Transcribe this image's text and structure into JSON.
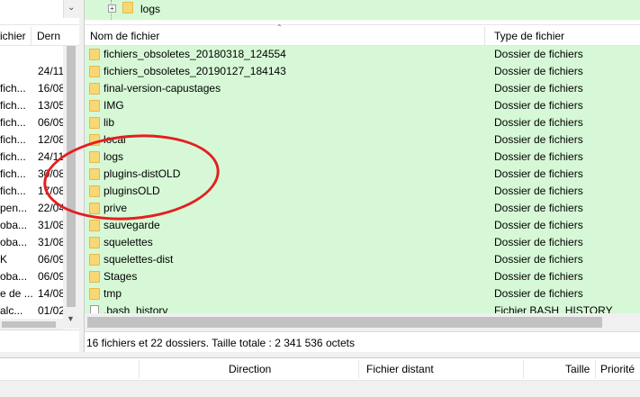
{
  "local_panel": {
    "columns": [
      "ichier",
      "Dern"
    ],
    "rows": [
      {
        "name": "",
        "date": ""
      },
      {
        "name": "",
        "date": "24/11"
      },
      {
        "name": "fich...",
        "date": "16/08"
      },
      {
        "name": "fich...",
        "date": "13/05"
      },
      {
        "name": "fich...",
        "date": "06/09"
      },
      {
        "name": "fich...",
        "date": "12/08"
      },
      {
        "name": "fich...",
        "date": "24/11"
      },
      {
        "name": "fich...",
        "date": "30/08"
      },
      {
        "name": "fich...",
        "date": "17/08"
      },
      {
        "name": "pen...",
        "date": "22/04"
      },
      {
        "name": "oba...",
        "date": "31/08"
      },
      {
        "name": "oba...",
        "date": "31/08"
      },
      {
        "name": "K",
        "date": "06/09"
      },
      {
        "name": "oba...",
        "date": "06/09"
      },
      {
        "name": "e de ...",
        "date": "14/08"
      },
      {
        "name": "alc...",
        "date": "01/02"
      }
    ]
  },
  "remote_panel": {
    "tree_item": "logs",
    "columns": {
      "name": "Nom de fichier",
      "type": "Type de fichier"
    },
    "rows": [
      {
        "name": "fichiers_obsoletes_20180318_124554",
        "type": "Dossier de fichiers",
        "icon": "folder"
      },
      {
        "name": "fichiers_obsoletes_20190127_184143",
        "type": "Dossier de fichiers",
        "icon": "folder"
      },
      {
        "name": "final-version-capustages",
        "type": "Dossier de fichiers",
        "icon": "folder"
      },
      {
        "name": "IMG",
        "type": "Dossier de fichiers",
        "icon": "folder"
      },
      {
        "name": "lib",
        "type": "Dossier de fichiers",
        "icon": "folder"
      },
      {
        "name": "local",
        "type": "Dossier de fichiers",
        "icon": "folder"
      },
      {
        "name": "logs",
        "type": "Dossier de fichiers",
        "icon": "folder"
      },
      {
        "name": "plugins-distOLD",
        "type": "Dossier de fichiers",
        "icon": "folder"
      },
      {
        "name": "pluginsOLD",
        "type": "Dossier de fichiers",
        "icon": "folder"
      },
      {
        "name": "prive",
        "type": "Dossier de fichiers",
        "icon": "folder"
      },
      {
        "name": "sauvegarde",
        "type": "Dossier de fichiers",
        "icon": "folder"
      },
      {
        "name": "squelettes",
        "type": "Dossier de fichiers",
        "icon": "folder"
      },
      {
        "name": "squelettes-dist",
        "type": "Dossier de fichiers",
        "icon": "folder"
      },
      {
        "name": "Stages",
        "type": "Dossier de fichiers",
        "icon": "folder"
      },
      {
        "name": "tmp",
        "type": "Dossier de fichiers",
        "icon": "folder"
      },
      {
        "name": ".bash_history",
        "type": "Fichier BASH_HISTORY",
        "icon": "file"
      }
    ],
    "status": "16 fichiers et 22 dossiers. Taille totale : 2 341 536 octets"
  },
  "queue": {
    "columns": {
      "direction": "Direction",
      "remote_file": "Fichier distant",
      "size": "Taille",
      "priority": "Priorité"
    }
  },
  "colors": {
    "row_highlight": "#d6f8d6",
    "annotation": "#e41f1f",
    "folder": "#f8d775"
  }
}
